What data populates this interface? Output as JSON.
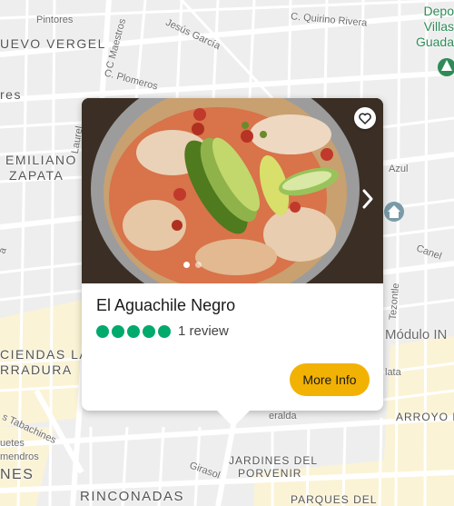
{
  "map": {
    "labels": {
      "pintores": "Pintores",
      "c_quirino_rivera": "C. Quirino Rivera",
      "nuevo_vergel": "UEVO VERGEL",
      "c_maestros": "C Maestros",
      "jesus_garcia": "Jesús García",
      "c_plomeros": "C. Plomeros",
      "res": "res",
      "emiliano_zapata_1": "EMILIANO",
      "emiliano_zapata_2": "ZAPATA",
      "laurel": "Laurel",
      "azul": "Azul",
      "cielo": "a",
      "canel": "Canel",
      "tezontle": "Tezontle",
      "modulo": "Módulo IN",
      "haciendas_1": "CIENDAS LA",
      "haciendas_2": "RRADURA",
      "plata": "lata",
      "tabachines_1": "s Tabachines",
      "tabachines_2": "uetes",
      "tabachines_3": "mendros",
      "nes": "NES",
      "girasol": "Girasol",
      "jardines_1": "JARDINES DEL",
      "jardines_2": "PORVENIR",
      "esmeralda": "eralda",
      "arroyo": "ARROYO H",
      "rinconadas": "RINCONADAS",
      "parques": "PARQUES DEL",
      "poi_1": "Depo",
      "poi_2": "Villas",
      "poi_3": "Guada"
    },
    "colors": {
      "background": "#eeeeee",
      "road": "#ffffff",
      "highlight_area": "#fbf3d5",
      "poi": "#2e8b57"
    }
  },
  "card": {
    "title": "El Aguachile Negro",
    "rating": 5,
    "rating_max": 5,
    "review_text": "1 review",
    "more_info_label": "More Info",
    "favorite_icon": "heart-outline-icon",
    "next_icon": "chevron-right-icon",
    "photo_count": 2,
    "photo_index": 1,
    "colors": {
      "rating": "#00aa6c",
      "button": "#f2b203"
    }
  }
}
